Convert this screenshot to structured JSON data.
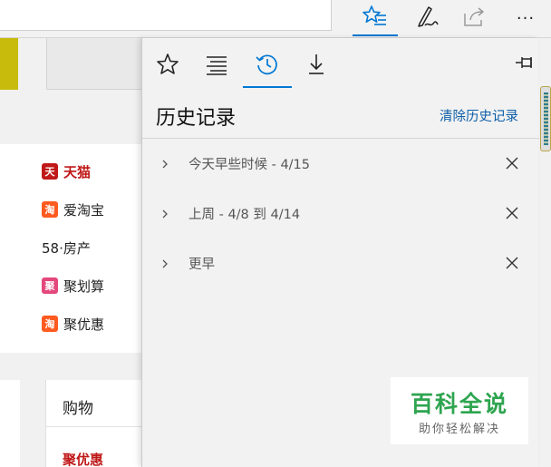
{
  "toolbar": {
    "buttons": [
      {
        "name": "favorites-hub",
        "icon": "star-lines-icon",
        "active": true
      },
      {
        "name": "web-note",
        "icon": "pen-icon"
      },
      {
        "name": "share",
        "icon": "share-icon"
      },
      {
        "name": "more",
        "icon": "more-icon",
        "label": "···"
      }
    ]
  },
  "page": {
    "links": [
      {
        "label": "天猫",
        "badge": "天",
        "style": "tmall"
      },
      {
        "label": "爱淘宝",
        "badge": "淘",
        "style": "taobao"
      },
      {
        "label": "58·房产",
        "badge": "",
        "style": "plain"
      },
      {
        "label": "聚划算",
        "badge": "聚",
        "style": "juhua"
      },
      {
        "label": "聚优惠",
        "badge": "淘",
        "style": "taobao"
      }
    ],
    "shopping_title": "购物",
    "shopping_first": "聚优惠"
  },
  "hub": {
    "tabs": [
      {
        "name": "favorites",
        "icon": "star-icon"
      },
      {
        "name": "reading-list",
        "icon": "reading-list-icon"
      },
      {
        "name": "history",
        "icon": "history-icon",
        "active": true
      },
      {
        "name": "downloads",
        "icon": "download-icon"
      }
    ],
    "title": "历史记录",
    "clear_label": "清除历史记录",
    "groups": [
      {
        "label": "今天早些时候 - 4/15"
      },
      {
        "label": "上周 - 4/8 到 4/14"
      },
      {
        "label": "更早"
      }
    ]
  },
  "watermark": {
    "title": "百科全说",
    "subtitle": "助你轻松解决"
  },
  "colors": {
    "accent": "#0078d4",
    "link": "#0c5ea8",
    "tmall_red": "#c01818",
    "watermark_green": "#2ea44f"
  }
}
